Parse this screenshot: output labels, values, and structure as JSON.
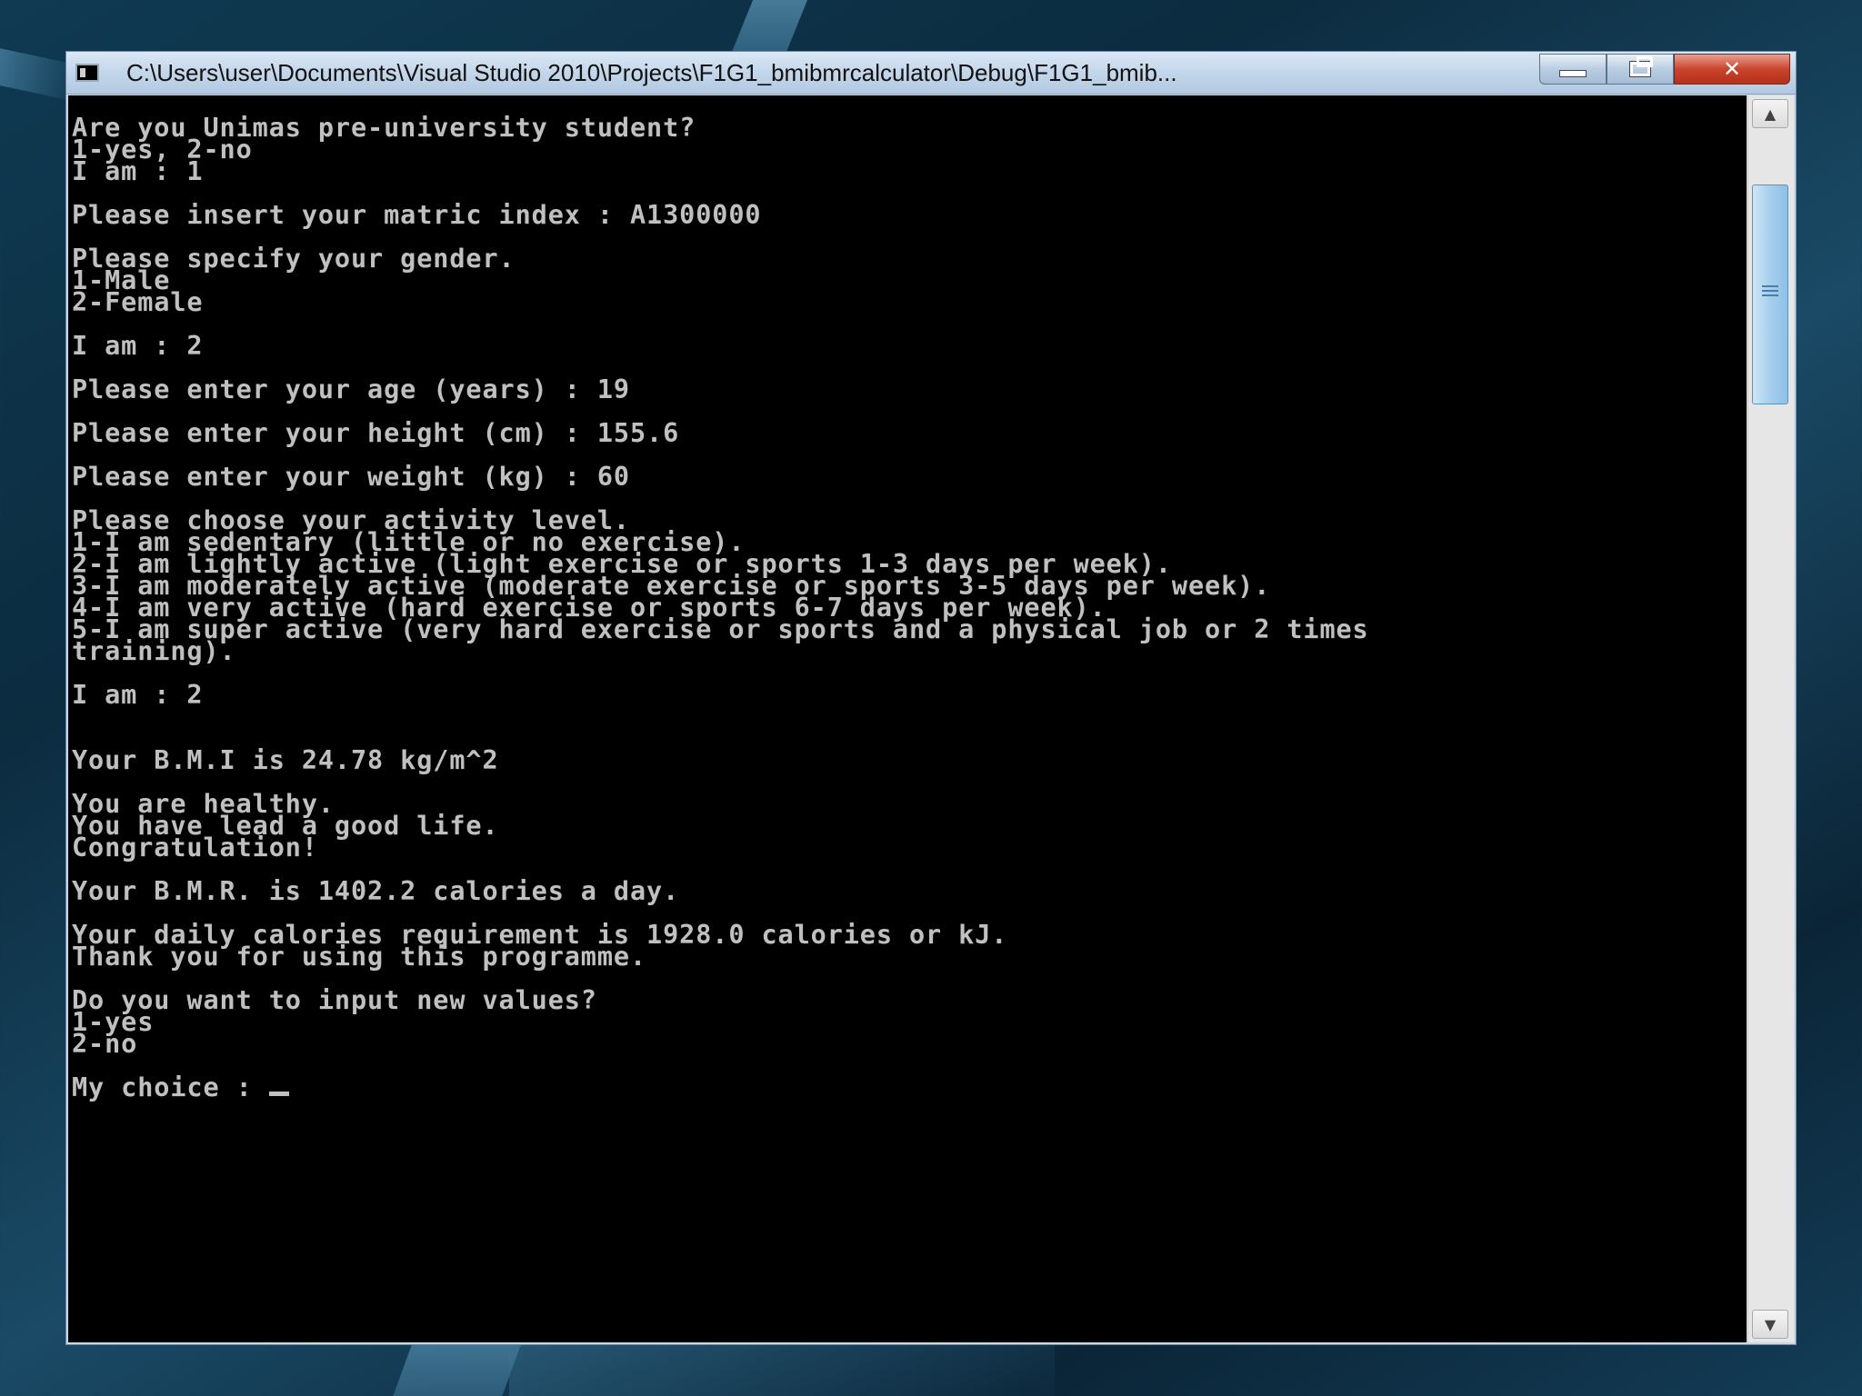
{
  "window": {
    "title": "C:\\Users\\user\\Documents\\Visual Studio 2010\\Projects\\F1G1_bmibmrcalculator\\Debug\\F1G1_bmib..."
  },
  "caption_buttons": {
    "minimize_icon": "minimize-icon",
    "maximize_icon": "restore-icon",
    "close_label": "✕"
  },
  "console": {
    "lines": [
      "Are you Unimas pre-university student?",
      "1-yes, 2-no",
      "I am : 1",
      "",
      "Please insert your matric index : A1300000",
      "",
      "Please specify your gender.",
      "1-Male",
      "2-Female",
      "",
      "I am : 2",
      "",
      "Please enter your age (years) : 19",
      "",
      "Please enter your height (cm) : 155.6",
      "",
      "Please enter your weight (kg) : 60",
      "",
      "Please choose your activity level.",
      "1-I am sedentary (little or no exercise).",
      "2-I am lightly active (light exercise or sports 1-3 days per week).",
      "3-I am moderately active (moderate exercise or sports 3-5 days per week).",
      "4-I am very active (hard exercise or sports 6-7 days per week).",
      "5-I am super active (very hard exercise or sports and a physical job or 2 times",
      "training).",
      "",
      "I am : 2",
      "",
      "",
      "Your B.M.I is 24.78 kg/m^2",
      "",
      "You are healthy.",
      "You have lead a good life.",
      "Congratulation!",
      "",
      "Your B.M.R. is 1402.2 calories a day.",
      "",
      "Your daily calories requirement is 1928.0 calories or kJ.",
      "Thank you for using this programme.",
      "",
      "Do you want to input new values?",
      "1-yes",
      "2-no",
      ""
    ],
    "prompt": "My choice : "
  },
  "scrollbar": {
    "up_icon": "▲",
    "down_icon": "▼"
  },
  "colors": {
    "console_bg": "#000000",
    "console_text": "#c0c0c0",
    "close_button": "#c9452c"
  }
}
